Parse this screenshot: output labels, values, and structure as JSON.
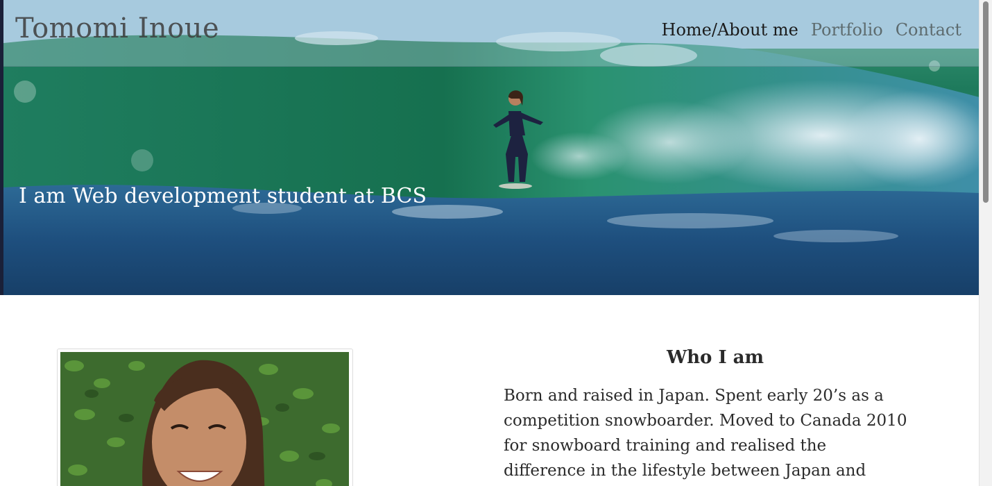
{
  "site": {
    "brand": "Tomomi Inoue",
    "nav": [
      {
        "label": "Home/About me",
        "active": true
      },
      {
        "label": "Portfolio",
        "active": false
      },
      {
        "label": "Contact",
        "active": false
      }
    ]
  },
  "hero": {
    "tagline": "I am Web development student at BCS",
    "image": "surfer-riding-wave"
  },
  "about": {
    "photo": "portrait-smiling-woman",
    "heading": "Who I am",
    "bio": "Born and raised in Japan. Spent early 20’s as a competition snowboarder. Moved to Canada 2010 for snowboard training and realised the difference in the lifestyle between Japan and Western culture, and"
  },
  "colors": {
    "nav_active": "#1b1b1b",
    "nav_inactive": "#5d6b6e",
    "tagline": "#ffffff"
  }
}
